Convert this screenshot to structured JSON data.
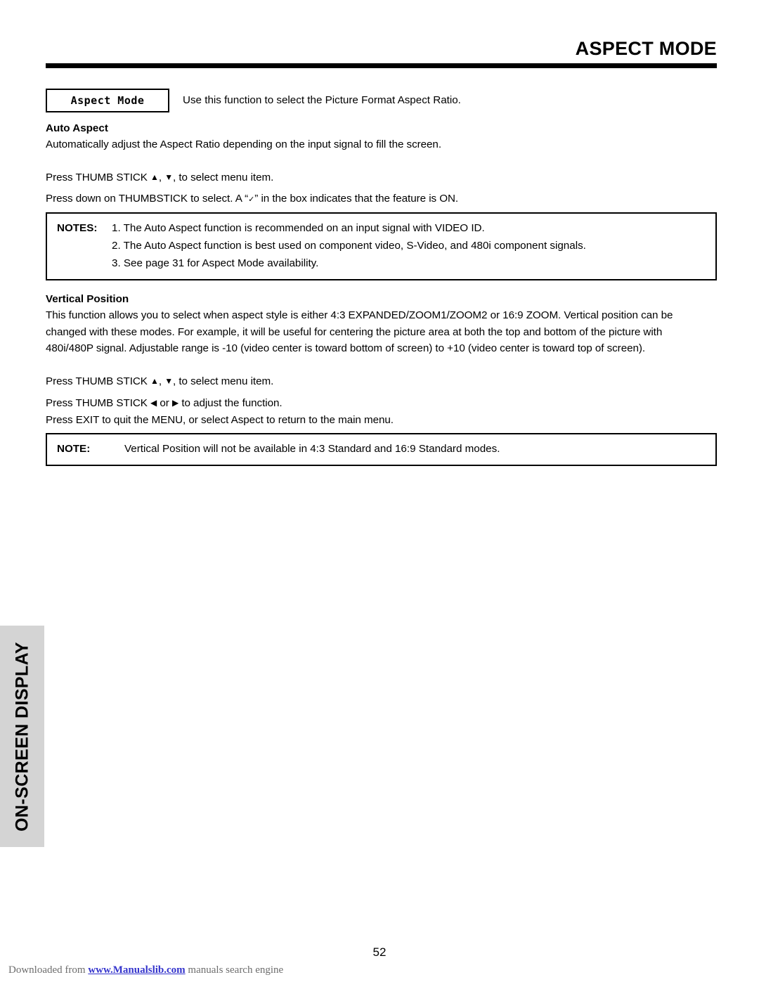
{
  "header": {
    "title": "ASPECT MODE"
  },
  "mode": {
    "chip_label": "Aspect Mode",
    "description": "Use this function to select the Picture Format Aspect Ratio."
  },
  "auto_aspect": {
    "heading": "Auto Aspect",
    "body": "Automatically adjust the Aspect Ratio depending on the input signal to fill the screen.",
    "instruction_1_pre": "Press THUMB STICK ",
    "instruction_1_post": ", to select menu item.",
    "up_arrow_icon": "▲",
    "down_arrow_icon": "▼",
    "instruction_2_pre": "Press down on THUMBSTICK to select.  A “",
    "check_icon": "✓",
    "instruction_2_post": "” in the box indicates that the feature is ON."
  },
  "notes_box": {
    "label": "NOTES:",
    "items": [
      "1. The Auto Aspect function is recommended on an input signal with VIDEO ID.",
      "2. The Auto Aspect function is best used on component video, S-Video, and 480i component signals.",
      "3. See page 31 for Aspect Mode availability."
    ]
  },
  "vertical_position": {
    "heading": "Vertical Position",
    "body_line_1": "This function allows you to select when aspect style is either 4:3 EXPANDED/ZOOM1/ZOOM2 or 16:9 ZOOM.  Vertical position can be",
    "body_line_2": "changed with these modes.  For example, it will be useful for centering the picture area at both the top and bottom of the picture with",
    "body_line_3": "480i/480P signal.  Adjustable range is -10 (video center is toward bottom of screen) to +10 (video center is toward top of screen).",
    "instruction_1_pre": "Press THUMB STICK ",
    "instruction_1_post": ", to select menu item.",
    "up_arrow_icon": "▲",
    "down_arrow_icon": "▼",
    "instruction_2_pre": "Press THUMB STICK  ",
    "left_arrow_icon": "◀",
    "instruction_2_mid": " or ",
    "right_arrow_icon": "▶",
    "instruction_2_post": " to adjust the function.",
    "instruction_3": "Press EXIT to quit the MENU, or select Aspect to return to the main menu."
  },
  "note_box": {
    "label": "NOTE:",
    "text": "Vertical Position will not be available in 4:3 Standard and 16:9 Standard modes."
  },
  "side_tab": {
    "label": "ON-SCREEN DISPLAY",
    "background_color": "#d4d4d4"
  },
  "page_number": "52",
  "footer": {
    "prefix": "Downloaded from ",
    "link": "www.Manualslib.com",
    "suffix": " manuals search engine",
    "link_color": "#3333cc"
  }
}
